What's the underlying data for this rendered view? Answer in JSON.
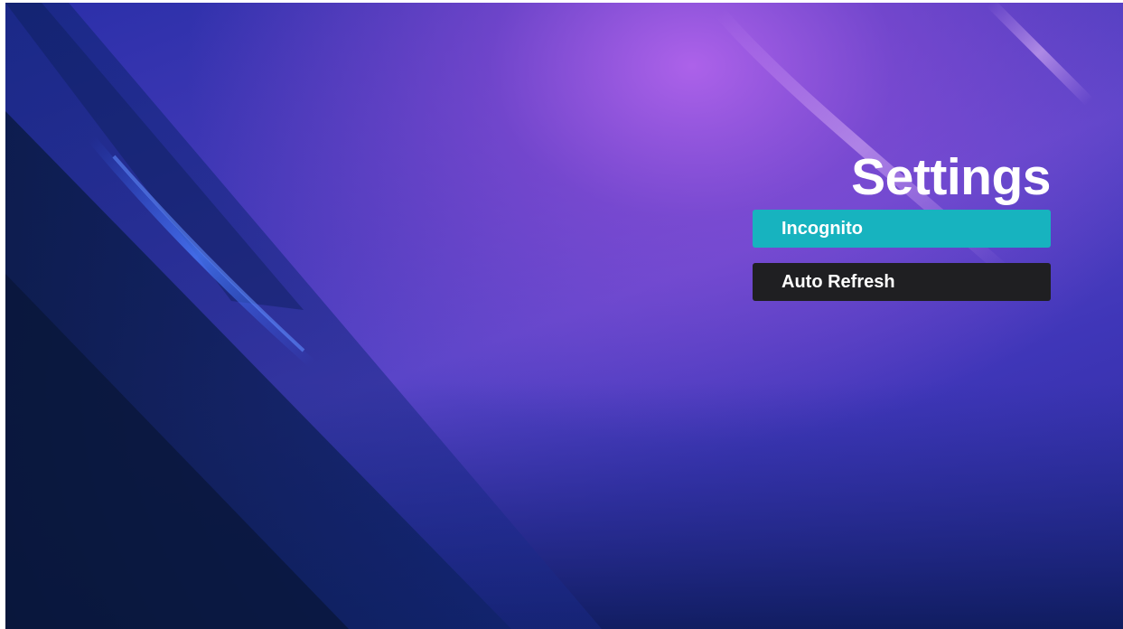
{
  "screen": {
    "title": "Settings"
  },
  "menu": {
    "items": [
      {
        "label": "Incognito",
        "state": "focused"
      },
      {
        "label": "Auto Refresh",
        "state": "default"
      }
    ]
  },
  "colors": {
    "focused_item": "#17b3bf",
    "default_item": "#1f1f22",
    "title_text": "#ffffff",
    "background_dark": "#0c1a48",
    "background_glow": "#b264ec"
  }
}
